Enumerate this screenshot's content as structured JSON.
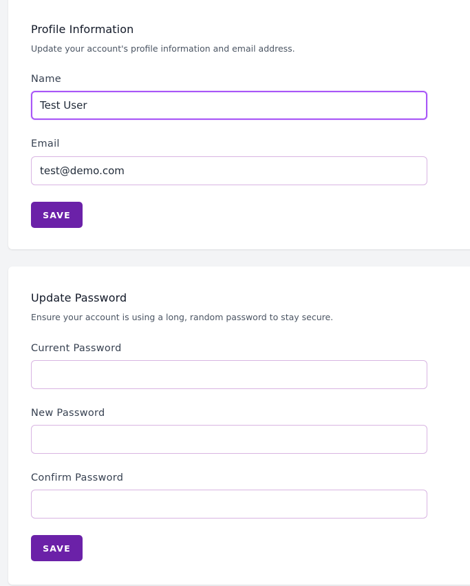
{
  "profile": {
    "title": "Profile Information",
    "description": "Update your account's profile information and email address.",
    "name_label": "Name",
    "name_value": "Test User",
    "email_label": "Email",
    "email_value": "test@demo.com",
    "save_label": "SAVE"
  },
  "password": {
    "title": "Update Password",
    "description": "Ensure your account is using a long, random password to stay secure.",
    "current_label": "Current Password",
    "current_value": "",
    "new_label": "New Password",
    "new_value": "",
    "confirm_label": "Confirm Password",
    "confirm_value": "",
    "save_label": "SAVE"
  },
  "colors": {
    "primary": "#6b21a8",
    "focus_border": "#a855f7",
    "input_border": "#d8b4e2",
    "page_background": "#f3f4f6"
  }
}
